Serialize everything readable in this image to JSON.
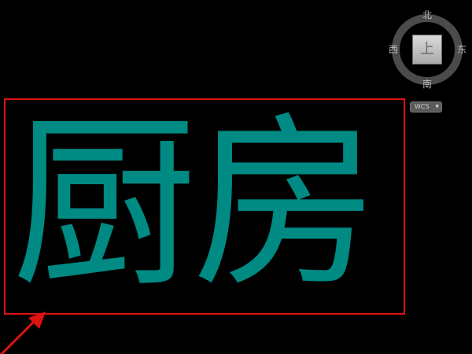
{
  "viewcube": {
    "north": "北",
    "south": "南",
    "east": "东",
    "west": "西",
    "face": "上"
  },
  "wcs": {
    "label": "WCS"
  },
  "drawing": {
    "text": "厨房",
    "text_color": "#008a84",
    "selection_color": "#e01010",
    "arrow_color": "#e01010"
  }
}
